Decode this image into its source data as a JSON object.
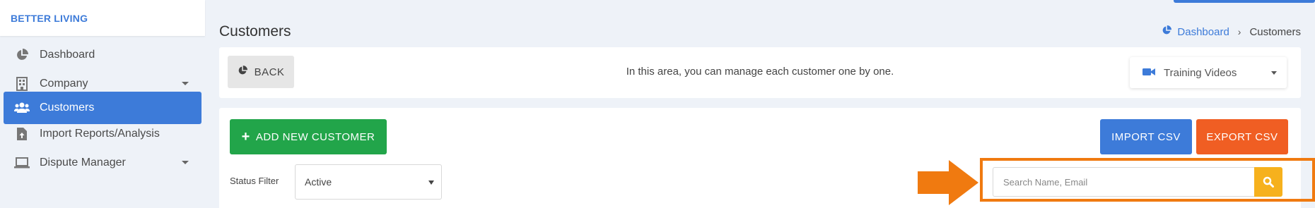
{
  "brand": "BETTER LIVING",
  "sidebar": {
    "items": [
      {
        "label": "Dashboard",
        "icon": "pie-chart-icon"
      },
      {
        "label": "Company",
        "icon": "building-icon"
      },
      {
        "label": "Customers",
        "icon": "users-icon"
      },
      {
        "label": "Import Reports/Analysis",
        "icon": "file-upload-icon"
      },
      {
        "label": "Dispute Manager",
        "icon": "laptop-icon"
      }
    ]
  },
  "header": {
    "title": "Customers",
    "breadcrumb": {
      "home": "Dashboard",
      "current": "Customers"
    }
  },
  "info_card": {
    "back_label": "BACK",
    "message": "In this area, you can manage each customer one by one.",
    "training_label": "Training Videos"
  },
  "actions": {
    "add_label": "ADD NEW CUSTOMER",
    "import_label": "IMPORT CSV",
    "export_label": "EXPORT CSV"
  },
  "filters": {
    "status_label": "Status Filter",
    "status_value": "Active"
  },
  "search": {
    "placeholder": "Search Name, Email"
  },
  "colors": {
    "primary": "#3d7bd9",
    "success": "#22a54a",
    "danger": "#f05e23",
    "warning": "#f6b11d",
    "highlight": "#f07a10"
  }
}
